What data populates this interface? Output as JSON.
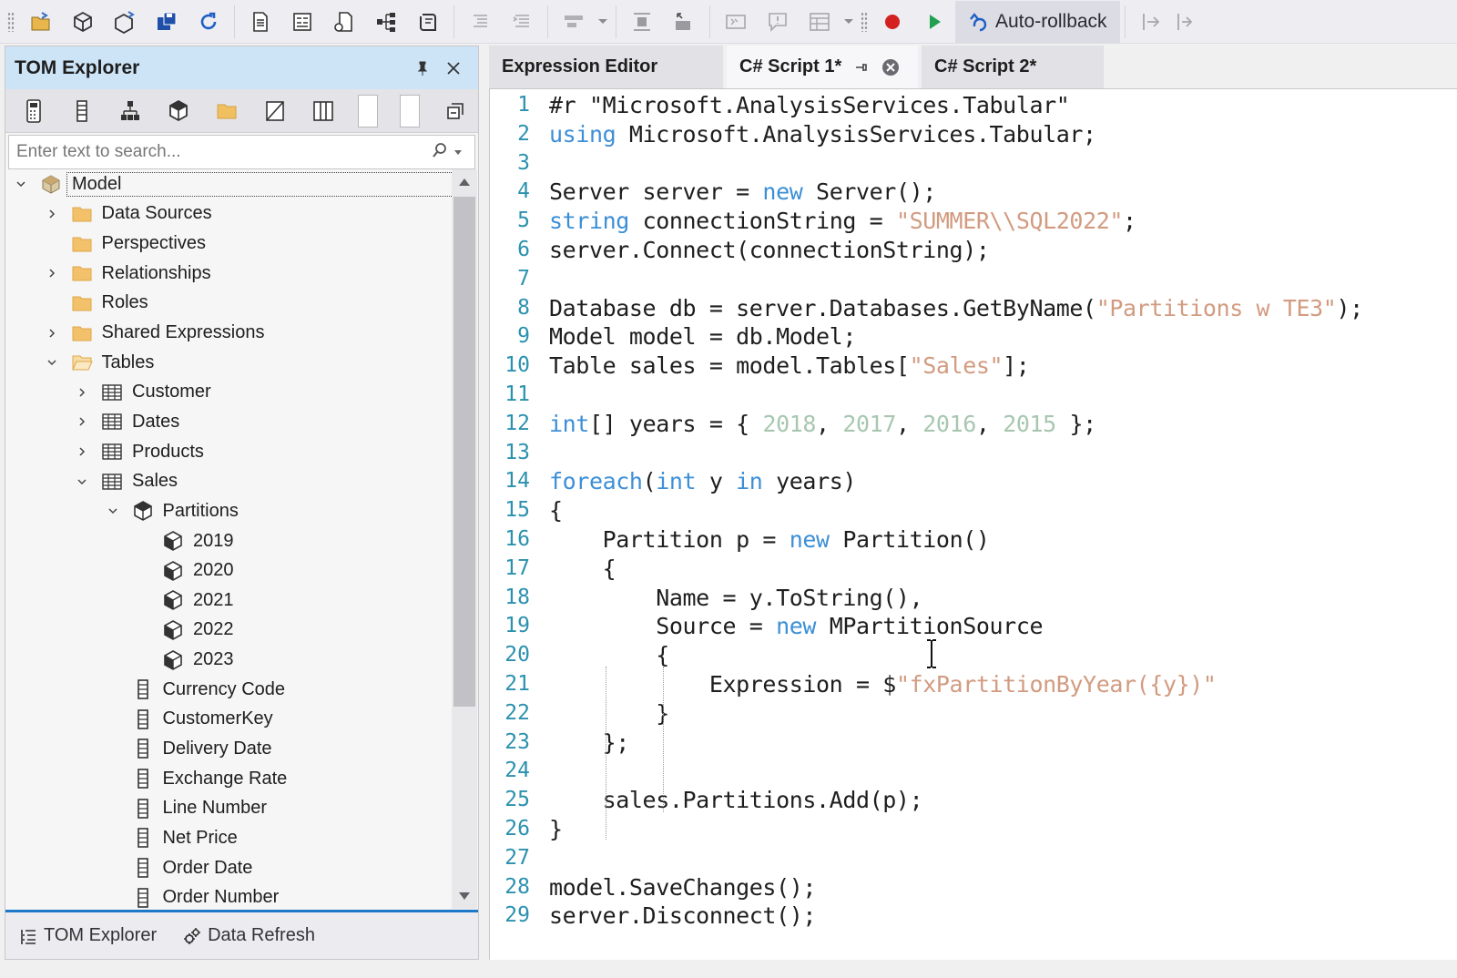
{
  "toolbar": {
    "buttons": [
      "open-icon",
      "model-icon",
      "deploy-icon",
      "save-icon",
      "refresh-icon",
      "document-icon",
      "form-icon",
      "script-icon",
      "hierarchy-icon",
      "undo-icon"
    ],
    "auto_rollback_label": "Auto-rollback",
    "colors": {
      "record": "#d42020",
      "run": "#22a050"
    }
  },
  "left_panel": {
    "title": "TOM Explorer",
    "search_placeholder": "Enter text to search...",
    "tree": [
      {
        "label": "Model",
        "level": 0,
        "expander": "expanded",
        "icon": "model-icon",
        "selected": true
      },
      {
        "label": "Data Sources",
        "level": 1,
        "expander": "collapsed",
        "icon": "folder-icon"
      },
      {
        "label": "Perspectives",
        "level": 1,
        "expander": "none",
        "icon": "folder-icon"
      },
      {
        "label": "Relationships",
        "level": 1,
        "expander": "collapsed",
        "icon": "folder-icon"
      },
      {
        "label": "Roles",
        "level": 1,
        "expander": "none",
        "icon": "folder-icon"
      },
      {
        "label": "Shared Expressions",
        "level": 1,
        "expander": "collapsed",
        "icon": "folder-icon"
      },
      {
        "label": "Tables",
        "level": 1,
        "expander": "expanded",
        "icon": "folder-open-icon"
      },
      {
        "label": "Customer",
        "level": 2,
        "expander": "collapsed",
        "icon": "table-icon"
      },
      {
        "label": "Dates",
        "level": 2,
        "expander": "collapsed",
        "icon": "table-icon"
      },
      {
        "label": "Products",
        "level": 2,
        "expander": "collapsed",
        "icon": "table-icon"
      },
      {
        "label": "Sales",
        "level": 2,
        "expander": "expanded",
        "icon": "table-icon"
      },
      {
        "label": "Partitions",
        "level": 3,
        "expander": "expanded",
        "icon": "partitions-icon"
      },
      {
        "label": "2019",
        "level": 4,
        "expander": "none",
        "icon": "partition-icon"
      },
      {
        "label": "2020",
        "level": 4,
        "expander": "none",
        "icon": "partition-icon"
      },
      {
        "label": "2021",
        "level": 4,
        "expander": "none",
        "icon": "partition-icon"
      },
      {
        "label": "2022",
        "level": 4,
        "expander": "none",
        "icon": "partition-icon"
      },
      {
        "label": "2023",
        "level": 4,
        "expander": "none",
        "icon": "partition-icon"
      },
      {
        "label": "Currency Code",
        "level": 3,
        "expander": "none",
        "icon": "column-icon"
      },
      {
        "label": "CustomerKey",
        "level": 3,
        "expander": "none",
        "icon": "column-icon"
      },
      {
        "label": "Delivery Date",
        "level": 3,
        "expander": "none",
        "icon": "column-icon"
      },
      {
        "label": "Exchange Rate",
        "level": 3,
        "expander": "none",
        "icon": "column-icon"
      },
      {
        "label": "Line Number",
        "level": 3,
        "expander": "none",
        "icon": "column-icon"
      },
      {
        "label": "Net Price",
        "level": 3,
        "expander": "none",
        "icon": "column-icon"
      },
      {
        "label": "Order Date",
        "level": 3,
        "expander": "none",
        "icon": "column-icon"
      },
      {
        "label": "Order Number",
        "level": 3,
        "expander": "none",
        "icon": "column-icon"
      }
    ],
    "bottom_tabs": [
      "TOM Explorer",
      "Data Refresh"
    ]
  },
  "editor": {
    "tabs": [
      {
        "label": "Expression Editor",
        "active": false
      },
      {
        "label": "C# Script 1*",
        "active": true
      },
      {
        "label": "C# Script 2*",
        "active": false
      }
    ],
    "lines": [
      [
        [
          "t",
          "#r "
        ],
        [
          "t",
          "\"Microsoft.AnalysisServices.Tabular\""
        ]
      ],
      [
        [
          "kw",
          "using"
        ],
        [
          "t",
          " Microsoft.AnalysisServices.Tabular;"
        ]
      ],
      [],
      [
        [
          "t",
          "Server server = "
        ],
        [
          "kw",
          "new"
        ],
        [
          "t",
          " Server();"
        ]
      ],
      [
        [
          "kw",
          "string"
        ],
        [
          "t",
          " connectionString = "
        ],
        [
          "str",
          "\"SUMMER\\\\SQL2022\""
        ],
        [
          "t",
          ";"
        ]
      ],
      [
        [
          "t",
          "server.Connect(connectionString);"
        ]
      ],
      [],
      [
        [
          "t",
          "Database db = server.Databases.GetByName("
        ],
        [
          "str",
          "\"Partitions w TE3\""
        ],
        [
          "t",
          ");"
        ]
      ],
      [
        [
          "t",
          "Model model = db.Model;"
        ]
      ],
      [
        [
          "t",
          "Table sales = model.Tables["
        ],
        [
          "str",
          "\"Sales\""
        ],
        [
          "t",
          "];"
        ]
      ],
      [],
      [
        [
          "kw",
          "int"
        ],
        [
          "t",
          "[] years = { "
        ],
        [
          "num",
          "2018"
        ],
        [
          "t",
          ", "
        ],
        [
          "num",
          "2017"
        ],
        [
          "t",
          ", "
        ],
        [
          "num",
          "2016"
        ],
        [
          "t",
          ", "
        ],
        [
          "num",
          "2015"
        ],
        [
          "t",
          " };"
        ]
      ],
      [],
      [
        [
          "kw",
          "foreach"
        ],
        [
          "t",
          "("
        ],
        [
          "kw",
          "int"
        ],
        [
          "t",
          " y "
        ],
        [
          "kw",
          "in"
        ],
        [
          "t",
          " years)"
        ]
      ],
      [
        [
          "t",
          "{"
        ]
      ],
      [
        [
          "t",
          "    Partition p = "
        ],
        [
          "kw",
          "new"
        ],
        [
          "t",
          " Partition()"
        ]
      ],
      [
        [
          "t",
          "    {"
        ]
      ],
      [
        [
          "t",
          "        Name = y.ToString(),"
        ]
      ],
      [
        [
          "t",
          "        Source = "
        ],
        [
          "kw",
          "new"
        ],
        [
          "t",
          " MPartitionSource"
        ]
      ],
      [
        [
          "t",
          "        {"
        ]
      ],
      [
        [
          "t",
          "            Expression = $"
        ],
        [
          "str",
          "\"fxPartitionByYear({y})\""
        ]
      ],
      [
        [
          "t",
          "        }"
        ]
      ],
      [
        [
          "t",
          "    };"
        ]
      ],
      [],
      [
        [
          "t",
          "    sales.Partitions.Add(p);"
        ]
      ],
      [
        [
          "t",
          "}"
        ]
      ],
      [],
      [
        [
          "t",
          "model.SaveChanges();"
        ]
      ],
      [
        [
          "t",
          "server.Disconnect();"
        ]
      ]
    ]
  }
}
